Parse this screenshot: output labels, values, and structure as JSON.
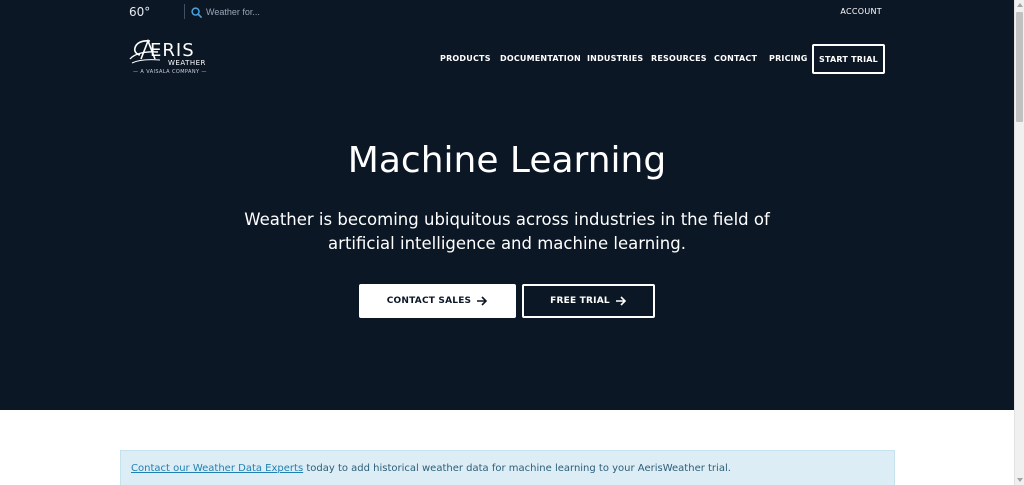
{
  "utility": {
    "temperature": "60°",
    "search_placeholder": "Weather for...",
    "account_label": "ACCOUNT"
  },
  "logo": {
    "word": "ERIS",
    "sub": "WEATHER",
    "tagline": "— A VAISALA COMPANY —"
  },
  "nav": {
    "items": [
      {
        "label": "PRODUCTS"
      },
      {
        "label": "DOCUMENTATION"
      },
      {
        "label": "INDUSTRIES"
      },
      {
        "label": "RESOURCES"
      },
      {
        "label": "CONTACT"
      },
      {
        "label": "PRICING"
      }
    ],
    "cta_label": "START TRIAL"
  },
  "hero": {
    "title": "Machine Learning",
    "subtitle": "Weather is becoming ubiquitous across industries in the field of artificial intelligence and machine learning.",
    "primary_button": "CONTACT SALES",
    "secondary_button": "FREE TRIAL"
  },
  "alert": {
    "link_text": "Contact our Weather Data Experts",
    "text": " today to add historical weather data for machine learning to your AerisWeather trial."
  },
  "colors": {
    "hero_bg": "#0c1726",
    "alert_bg": "#dcedf6",
    "link": "#2180b3"
  },
  "icons": [
    "search-icon",
    "arrow-right-icon",
    "scroll-up-arrow-icon",
    "scroll-down-arrow-icon"
  ]
}
